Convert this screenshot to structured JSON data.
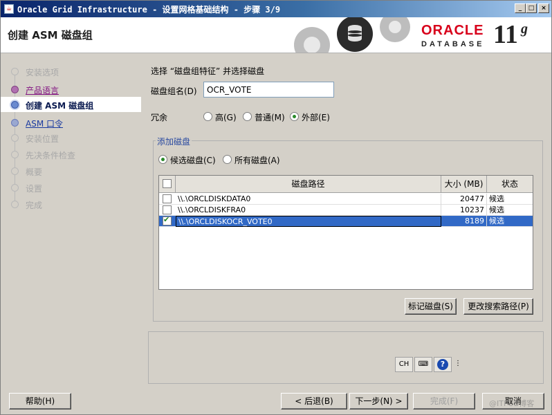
{
  "window": {
    "title": "Oracle Grid Infrastructure - 设置网格基础结构 - 步骤 3/9"
  },
  "header": {
    "page_title": "创建 ASM 磁盘组",
    "brand": "ORACLE",
    "product": "DATABASE",
    "version_number": "11",
    "version_letter": "g"
  },
  "steps": [
    {
      "label": "安装选项",
      "state": "done"
    },
    {
      "label": "产品语言",
      "state": "visited"
    },
    {
      "label": "创建 ASM 磁盘组",
      "state": "current"
    },
    {
      "label": "ASM 口令",
      "state": "link"
    },
    {
      "label": "安装位置",
      "state": "pending"
    },
    {
      "label": "先决条件检查",
      "state": "pending"
    },
    {
      "label": "概要",
      "state": "pending"
    },
    {
      "label": "设置",
      "state": "pending"
    },
    {
      "label": "完成",
      "state": "pending"
    }
  ],
  "form": {
    "intro": "选择 “磁盘组特征” 并选择磁盘",
    "diskgroup_label": "磁盘组名(D)",
    "diskgroup_value": "OCR_VOTE",
    "redundancy_label": "冗余",
    "redundancy_options": [
      {
        "label": "高(G)",
        "selected": false
      },
      {
        "label": "普通(M)",
        "selected": false
      },
      {
        "label": "外部(E)",
        "selected": true
      }
    ],
    "add_disks_title": "添加磁盘",
    "filter_options": [
      {
        "label": "候选磁盘(C)",
        "selected": true
      },
      {
        "label": "所有磁盘(A)",
        "selected": false
      }
    ]
  },
  "table": {
    "headers": {
      "path": "磁盘路径",
      "size": "大小 (MB)",
      "status": "状态"
    },
    "rows": [
      {
        "path": "\\\\.\\ORCLDISKDATA0",
        "size": "20477",
        "status": "候选",
        "checked": false,
        "selected": false
      },
      {
        "path": "\\\\.\\ORCLDISKFRA0",
        "size": "10237",
        "status": "候选",
        "checked": false,
        "selected": false
      },
      {
        "path": "\\\\.\\ORCLDISKOCR_VOTE0",
        "size": "8189",
        "status": "候选",
        "checked": true,
        "selected": true
      }
    ]
  },
  "buttons": {
    "stamp_disks": "标记磁盘(S)",
    "change_path": "更改搜索路径(P)",
    "help": "帮助(H)",
    "back": "< 后退(B)",
    "next": "下一步(N) >",
    "finish": "完成(F)",
    "cancel": "取消"
  },
  "ime": {
    "lang": "CH"
  },
  "watermark": "@ITPUB博客"
}
